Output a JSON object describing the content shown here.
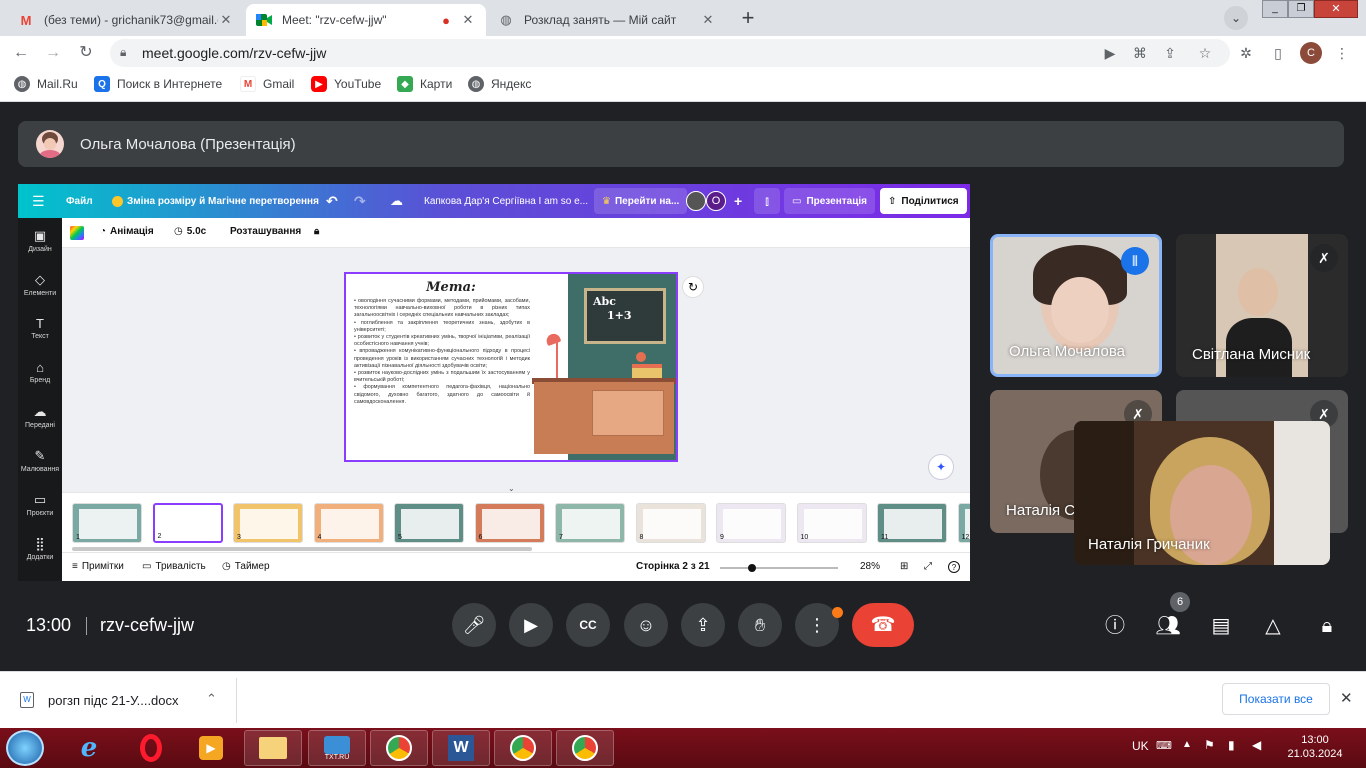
{
  "browser": {
    "tabs": [
      {
        "label": "(без теми) - grichanik73@gmail.c",
        "icon": "gmail-icon"
      },
      {
        "label": "Meet: \"rzv-cefw-jjw\"",
        "icon": "meet-icon"
      },
      {
        "label": "Розклад занять — Мій сайт",
        "icon": "globe-icon"
      }
    ],
    "url": "meet.google.com/rzv-cefw-jjw",
    "profile_initial": "C",
    "bookmarks": [
      {
        "label": "Mail.Ru"
      },
      {
        "label": "Поиск в Интернете"
      },
      {
        "label": "Gmail"
      },
      {
        "label": "YouTube"
      },
      {
        "label": "Карти"
      },
      {
        "label": "Яндекс"
      }
    ]
  },
  "meet": {
    "presenter_label": "Ольга Мочалова (Презентація)",
    "time": "13:00",
    "meeting_code": "rzv-cefw-jjw",
    "participants_count": "6",
    "participants": [
      {
        "name": "Ольга Мочалова"
      },
      {
        "name": "Світлана Мисник"
      },
      {
        "name": "Наталія С"
      },
      {
        "name": "Наталія Гричаник"
      }
    ]
  },
  "canva": {
    "top": {
      "file": "Файл",
      "resize": "Зміна розміру й Магічне перетворення",
      "doc_title": "Капкова Дар'я Сергіївна I am so e...",
      "go_to": "Перейти на...",
      "avatar_initial": "O",
      "present": "Презентація",
      "share": "Поділитися"
    },
    "toolbar": {
      "animation": "Анімація",
      "duration": "5.0с",
      "position": "Розташування"
    },
    "sidebar": [
      {
        "label": "Дизайн"
      },
      {
        "label": "Елементи"
      },
      {
        "label": "Текст"
      },
      {
        "label": "Бренд"
      },
      {
        "label": "Передані"
      },
      {
        "label": "Малювання"
      },
      {
        "label": "Проєкти"
      },
      {
        "label": "Додатки"
      }
    ],
    "slide": {
      "title": "Мета:",
      "board_line1": "Abc",
      "board_line2": "1+3",
      "bullets": [
        "оволодіння сучасними формами, методами, прийомами, засобами, технологіями навчально-виховної роботи в різних типах загальноосвітніх і середніх спеціальних навчальних закладах;",
        "поглиблення та закріплення теоретичних знань, здобутих в університеті;",
        "розвиток у студентів креативних умінь, творчої ініціативи, реалізації особистісного навчання учнів;",
        "впровадження комунікативно-функціонального підходу в процесі проведення уроків із використанням сучасних технологій і методик активізації пізнавальної діяльності здобувачів освіти;",
        "розвиток науково-дослідних умінь з подальшим їх застосуванням у вчительській роботі;",
        "формування компетентного педагога-фахівця, національно свідомого, духовно багатого, здатного до самоосвіти й самовдосконалення."
      ]
    },
    "thumbnails": [
      "1",
      "2",
      "3",
      "4",
      "5",
      "6",
      "7",
      "8",
      "9",
      "10",
      "11",
      "12"
    ],
    "bottom": {
      "notes": "Примітки",
      "duration": "Тривалість",
      "timer": "Таймер",
      "page": "Сторінка 2 з 21",
      "zoom": "28%"
    }
  },
  "downloads": {
    "file": "рогзп підс 21-У....docx",
    "show_all": "Показати все"
  },
  "taskbar": {
    "lang": "UK",
    "time": "13:00",
    "date": "21.03.2024",
    "app_label": "TXT.RU"
  }
}
